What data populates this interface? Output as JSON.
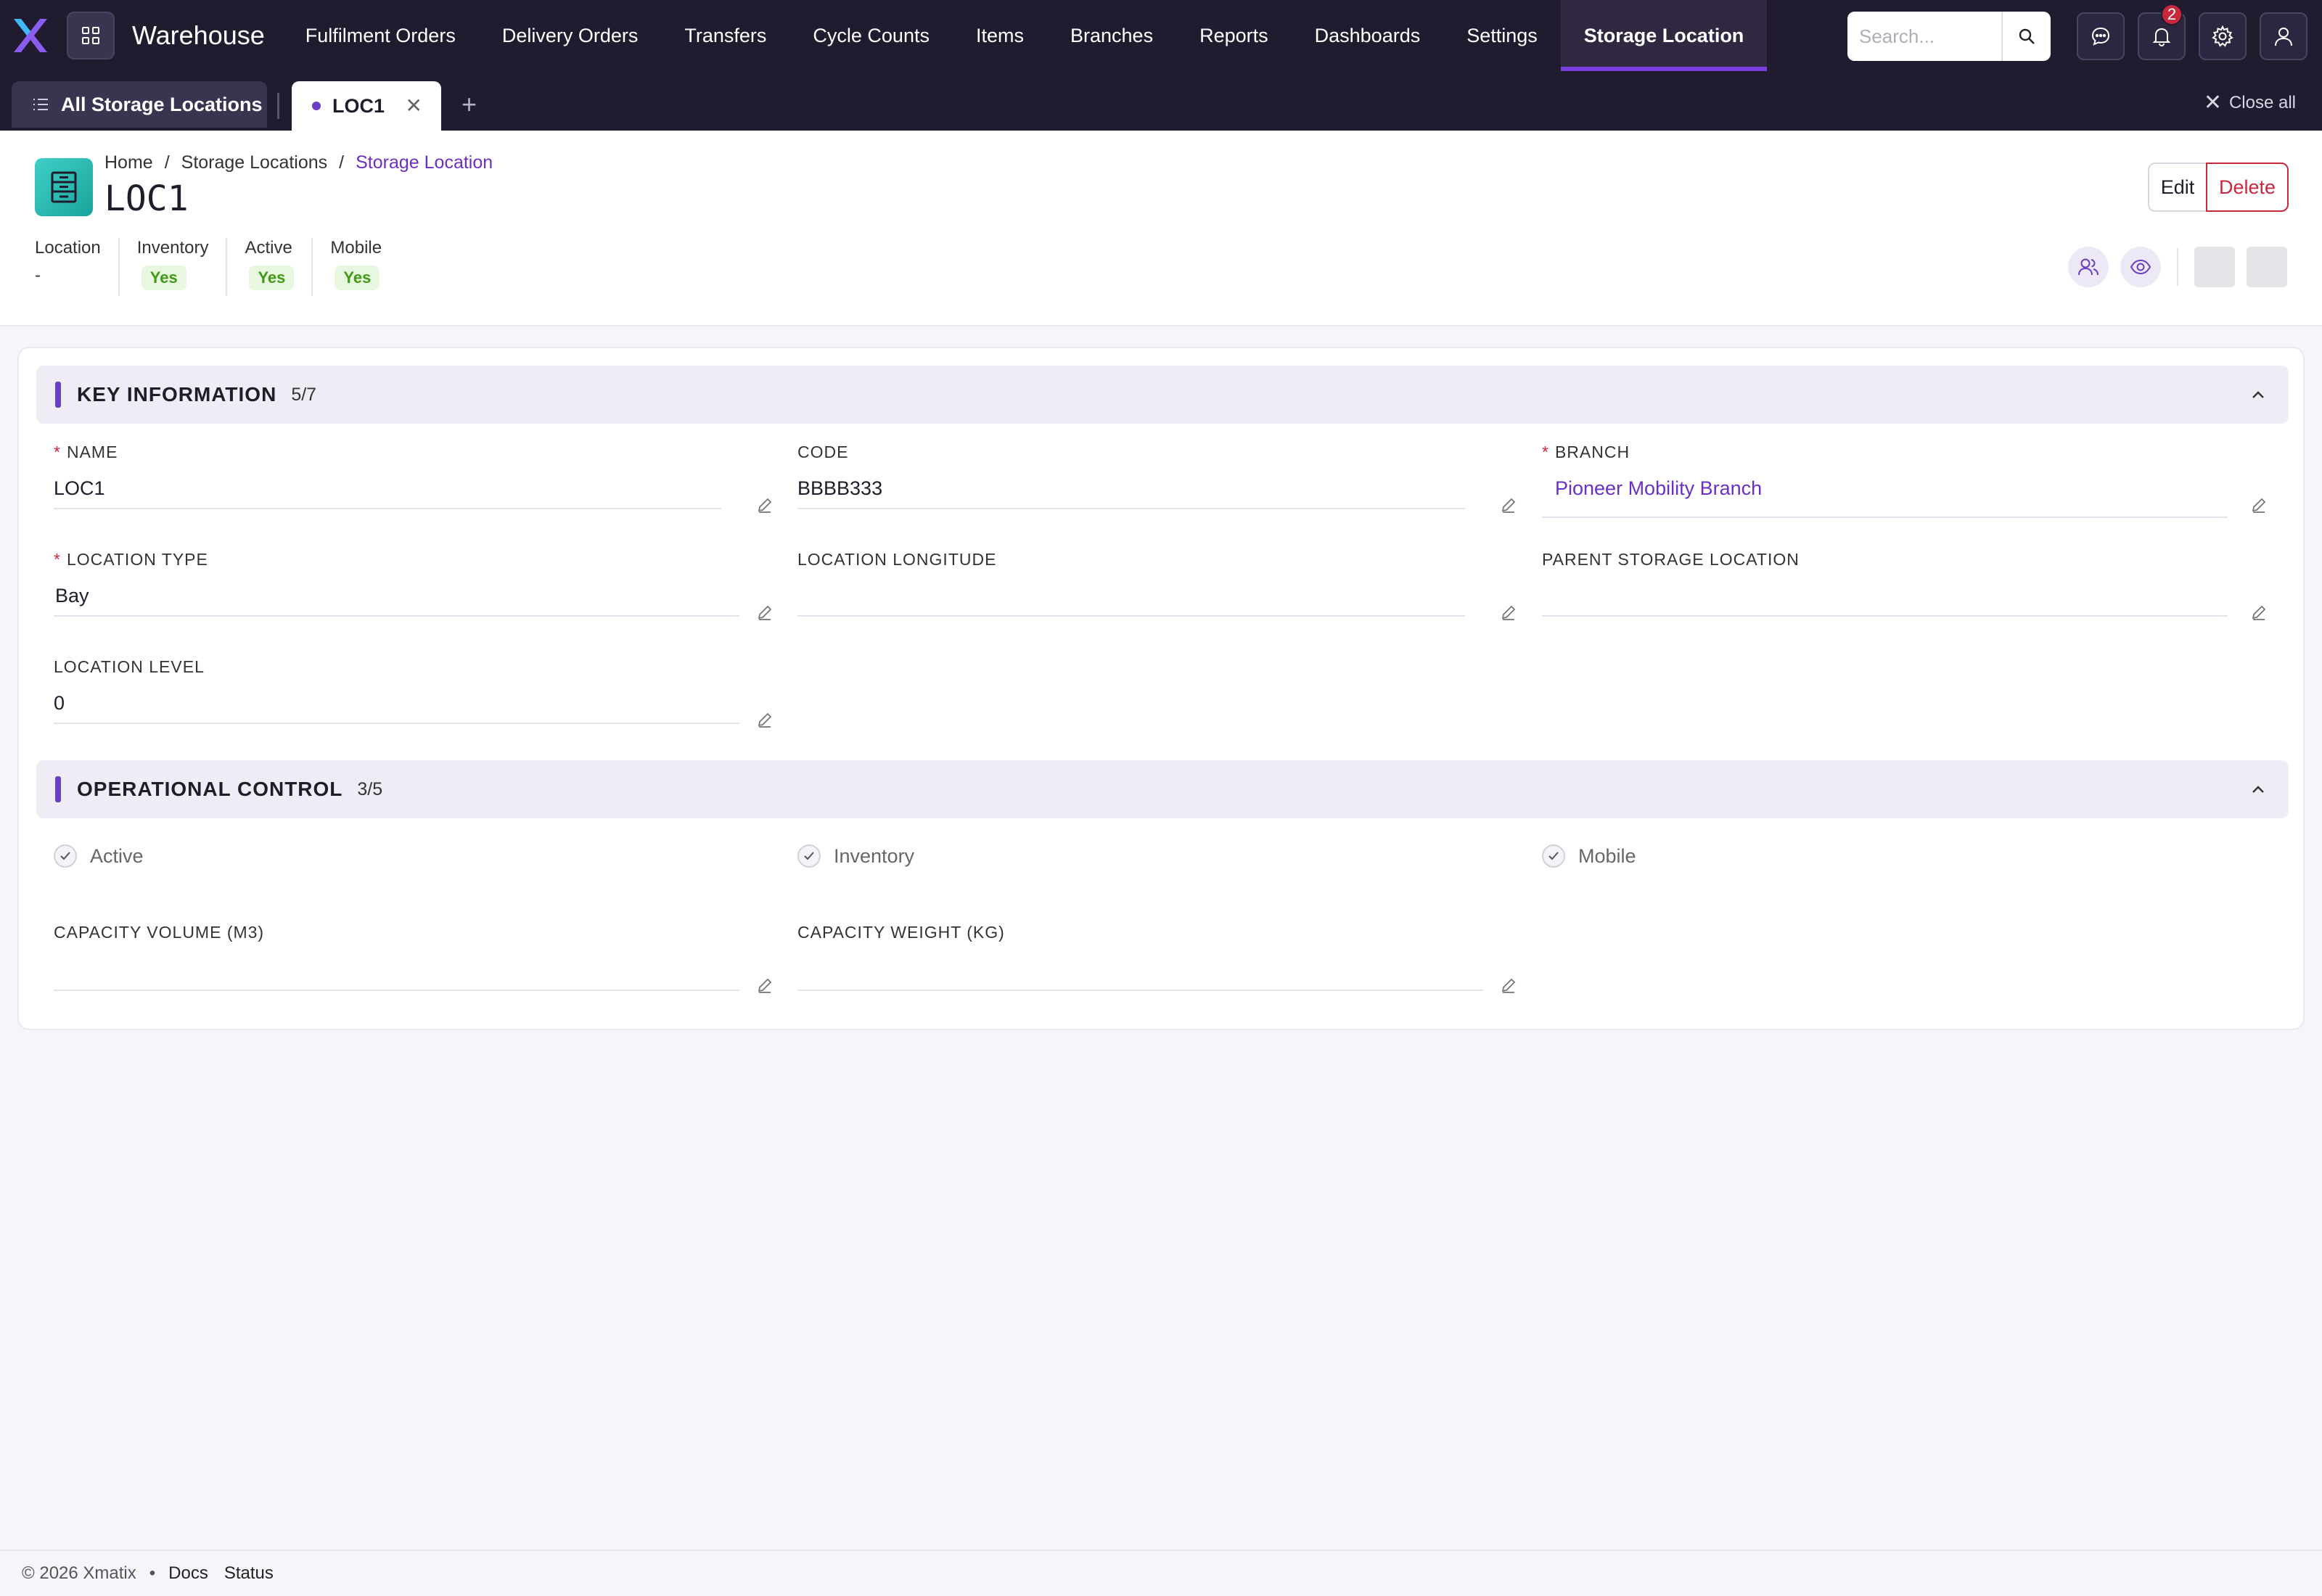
{
  "app": {
    "title": "Warehouse"
  },
  "nav": {
    "items": [
      "Fulfilment Orders",
      "Delivery Orders",
      "Transfers",
      "Cycle Counts",
      "Items",
      "Branches",
      "Reports",
      "Dashboards",
      "Settings",
      "Storage Location"
    ],
    "active": "Storage Location"
  },
  "search": {
    "placeholder": "Search..."
  },
  "notifications": {
    "count": "2"
  },
  "tabs": {
    "all_label": "All Storage Locations",
    "active_label": "LOC1",
    "close_all": "Close all"
  },
  "breadcrumb": {
    "home": "Home",
    "list": "Storage Locations",
    "current": "Storage Location"
  },
  "record": {
    "title": "LOC1"
  },
  "actions": {
    "edit": "Edit",
    "delete": "Delete"
  },
  "summary": [
    {
      "label": "Location",
      "value": "-"
    },
    {
      "label": "Inventory",
      "value": "Yes"
    },
    {
      "label": "Active",
      "value": "Yes"
    },
    {
      "label": "Mobile",
      "value": "Yes"
    }
  ],
  "sections": {
    "key_info": {
      "title": "KEY INFORMATION",
      "count": "5/7",
      "fields": {
        "name": {
          "label": "NAME",
          "value": "LOC1"
        },
        "code": {
          "label": "CODE",
          "value": "BBBB333"
        },
        "branch": {
          "label": "BRANCH",
          "value": "Pioneer Mobility Branch"
        },
        "location_type": {
          "label": "LOCATION TYPE",
          "value": "Bay"
        },
        "location_longitude": {
          "label": "LOCATION LONGITUDE",
          "value": ""
        },
        "parent_storage_location": {
          "label": "PARENT STORAGE LOCATION",
          "value": ""
        },
        "location_level": {
          "label": "LOCATION LEVEL",
          "value": "0"
        }
      }
    },
    "operational": {
      "title": "OPERATIONAL CONTROL",
      "count": "3/5",
      "checks": {
        "active": "Active",
        "inventory": "Inventory",
        "mobile": "Mobile"
      },
      "fields": {
        "capacity_volume": {
          "label": "CAPACITY VOLUME (M3)",
          "value": ""
        },
        "capacity_weight": {
          "label": "CAPACITY WEIGHT (KG)",
          "value": ""
        }
      }
    }
  },
  "footer": {
    "copyright": "© 2026 Xmatix",
    "docs": "Docs",
    "status": "Status"
  },
  "colors": {
    "accent": "#6b3fc4",
    "topbar": "#201b2e",
    "danger": "#c8283e",
    "success": "#3f9a16"
  },
  "icons": [
    "x-logo-icon",
    "apps-grid-icon",
    "search-icon",
    "chat-icon",
    "bell-icon",
    "gear-icon",
    "user-icon",
    "list-icon",
    "close-icon",
    "plus-icon",
    "storage-rack-icon",
    "followers-icon",
    "eye-icon",
    "pencil-icon",
    "chevron-up-icon",
    "check-icon"
  ]
}
